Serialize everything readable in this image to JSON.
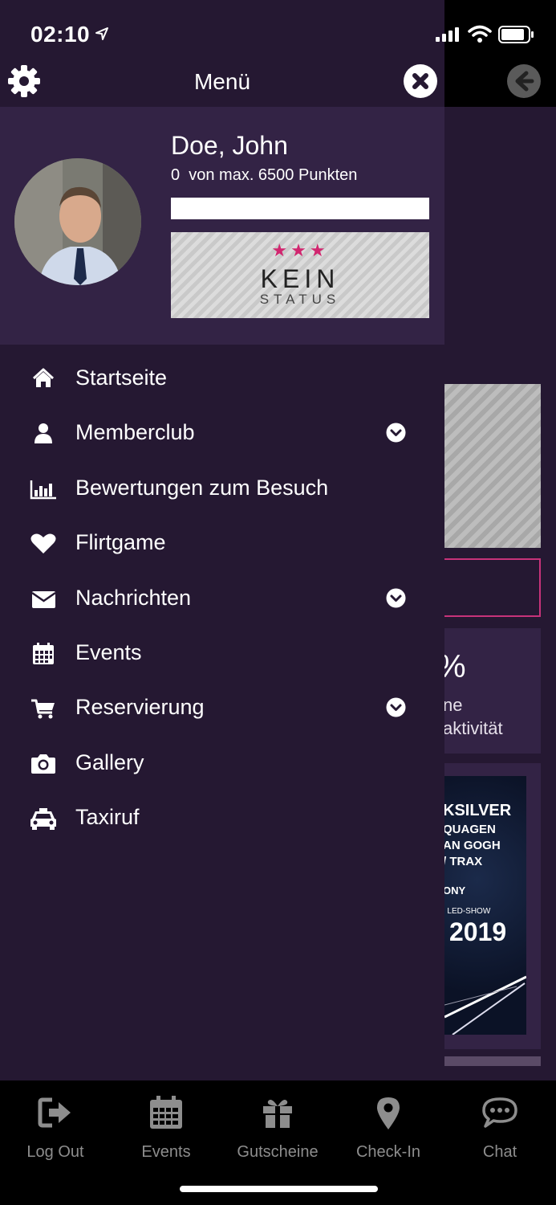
{
  "status_bar": {
    "time": "02:10"
  },
  "drawer": {
    "title": "Menü",
    "profile": {
      "name": "Doe, John",
      "points_text": "0  von max. 6500 Punkten",
      "points_current": 0,
      "points_max": 6500,
      "status_badge": {
        "stars": "★★★",
        "main": "KEIN",
        "sub": "STATUS"
      }
    },
    "menu": [
      {
        "label": "Startseite",
        "icon": "home-icon",
        "expandable": false
      },
      {
        "label": "Memberclub",
        "icon": "user-icon",
        "expandable": true
      },
      {
        "label": "Bewertungen zum Besuch",
        "icon": "bar-chart-icon",
        "expandable": false
      },
      {
        "label": "Flirtgame",
        "icon": "heart-icon",
        "expandable": false
      },
      {
        "label": "Nachrichten",
        "icon": "envelope-icon",
        "expandable": true
      },
      {
        "label": "Events",
        "icon": "calendar-icon",
        "expandable": false
      },
      {
        "label": "Reservierung",
        "icon": "cart-icon",
        "expandable": true
      },
      {
        "label": "Gallery",
        "icon": "camera-icon",
        "expandable": false
      },
      {
        "label": "Taxiruf",
        "icon": "taxi-icon",
        "expandable": false
      }
    ]
  },
  "background": {
    "percent_text": "%",
    "line1": "ne",
    "line2": "aktivität",
    "poster_lines": [
      "KSILVER",
      "QUAGEN",
      "AN GOGH",
      "/ TRAX",
      "ONY",
      "| LED-SHOW",
      "2019"
    ]
  },
  "tab_bar": [
    {
      "label": "Log Out",
      "icon": "logout-icon"
    },
    {
      "label": "Events",
      "icon": "calendar-icon"
    },
    {
      "label": "Gutscheine",
      "icon": "gift-icon"
    },
    {
      "label": "Check-In",
      "icon": "map-pin-icon"
    },
    {
      "label": "Chat",
      "icon": "chat-icon"
    }
  ],
  "colors": {
    "drawer_bg": "#251832",
    "profile_bg": "#332345",
    "accent": "#c7337a",
    "tab_inactive": "#8d8d8d"
  }
}
